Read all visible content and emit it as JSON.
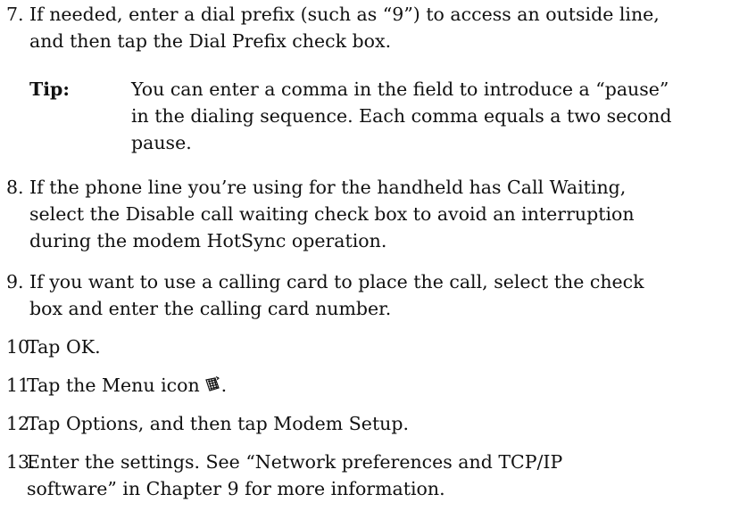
{
  "steps": [
    {
      "number": "7.",
      "lines": [
        "If needed, enter a dial prefix (such as “9”) to access an outside line,",
        "and then tap the Dial Prefix check box."
      ]
    },
    {
      "number": "8.",
      "lines": [
        "If the phone line you’re using for the handheld has Call Waiting,",
        "select the Disable call waiting check box to avoid an interruption",
        "during the modem HotSync operation."
      ]
    },
    {
      "number": "9.",
      "lines": [
        "If you want to use a calling card to place the call, select the check",
        "box and enter the calling card number."
      ]
    },
    {
      "number": "10.",
      "lines": [
        "Tap OK."
      ]
    },
    {
      "number": "11.",
      "text_before_icon": "Tap the Menu icon",
      "icon": "menu-icon",
      "text_after_icon": "."
    },
    {
      "number": "12.",
      "lines": [
        "Tap Options, and then tap Modem Setup."
      ]
    },
    {
      "number": "13.",
      "lines": [
        "Enter the settings. See “Network preferences and TCP/IP",
        "software” in Chapter 9 for more information."
      ]
    }
  ],
  "tip": {
    "label": "Tip:",
    "lines": [
      "You can enter a comma in the field to introduce a “pause”",
      "in the dialing sequence. Each comma equals a two second",
      "pause."
    ]
  }
}
